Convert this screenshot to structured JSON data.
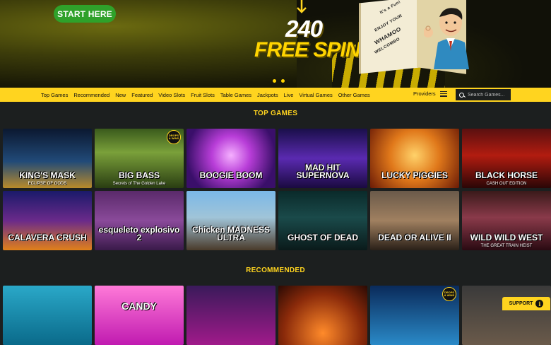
{
  "hero": {
    "cta_label": "START HERE",
    "promo_number": "240",
    "promo_text": "FREE SPINS",
    "box_labels": [
      "It's a Fun!",
      "ENJOY YOUR",
      "WHAMOO",
      "WELCOMBO"
    ],
    "carousel_dots": 2
  },
  "nav": {
    "items": [
      "Top Games",
      "Recommended",
      "New",
      "Featured",
      "Video Slots",
      "Fruit Slots",
      "Table Games",
      "Jackpots",
      "Live",
      "Virtual Games",
      "Other Games"
    ],
    "providers_label": "Providers",
    "search_placeholder": "Search Games..."
  },
  "top_games": {
    "title": "TOP GAMES",
    "tiles": [
      {
        "title": "KING'S MASK",
        "sub": "ECLIPSE OF GODS"
      },
      {
        "title": "BIG BASS",
        "sub": "Secrets of The Golden Lake",
        "badge": "DROPS & WINS"
      },
      {
        "title": "BOOGIE BOOM",
        "sub": ""
      },
      {
        "title": "MAD HIT SUPERNOVA",
        "sub": ""
      },
      {
        "title": "LUCKY PIGGIES",
        "sub": ""
      },
      {
        "title": "BLACK HORSE",
        "sub": "CASH OUT EDITION"
      },
      {
        "title": "CALAVERA CRUSH",
        "sub": ""
      },
      {
        "title": "esqueleto explosivo 2",
        "sub": ""
      },
      {
        "title": "Chicken MADNESS ULTRA",
        "sub": ""
      },
      {
        "title": "GHOST OF DEAD",
        "sub": ""
      },
      {
        "title": "DEAD OR ALIVE II",
        "sub": ""
      },
      {
        "title": "WILD WILD WEST",
        "sub": "THE GREAT TRAIN HEIST"
      }
    ]
  },
  "recommended": {
    "title": "RECOMMENDED",
    "tiles": [
      {
        "title": "",
        "sub": ""
      },
      {
        "title": "CANDY",
        "sub": ""
      },
      {
        "title": "",
        "sub": ""
      },
      {
        "title": "",
        "sub": ""
      },
      {
        "title": "",
        "sub": "",
        "badge": "DROPS & WINS"
      },
      {
        "title": "",
        "sub": ""
      }
    ]
  },
  "support": {
    "label": "SUPPORT"
  },
  "colors": {
    "accent": "#ffd41f",
    "cta": "#2fa12a",
    "background": "#1c1f1f"
  }
}
